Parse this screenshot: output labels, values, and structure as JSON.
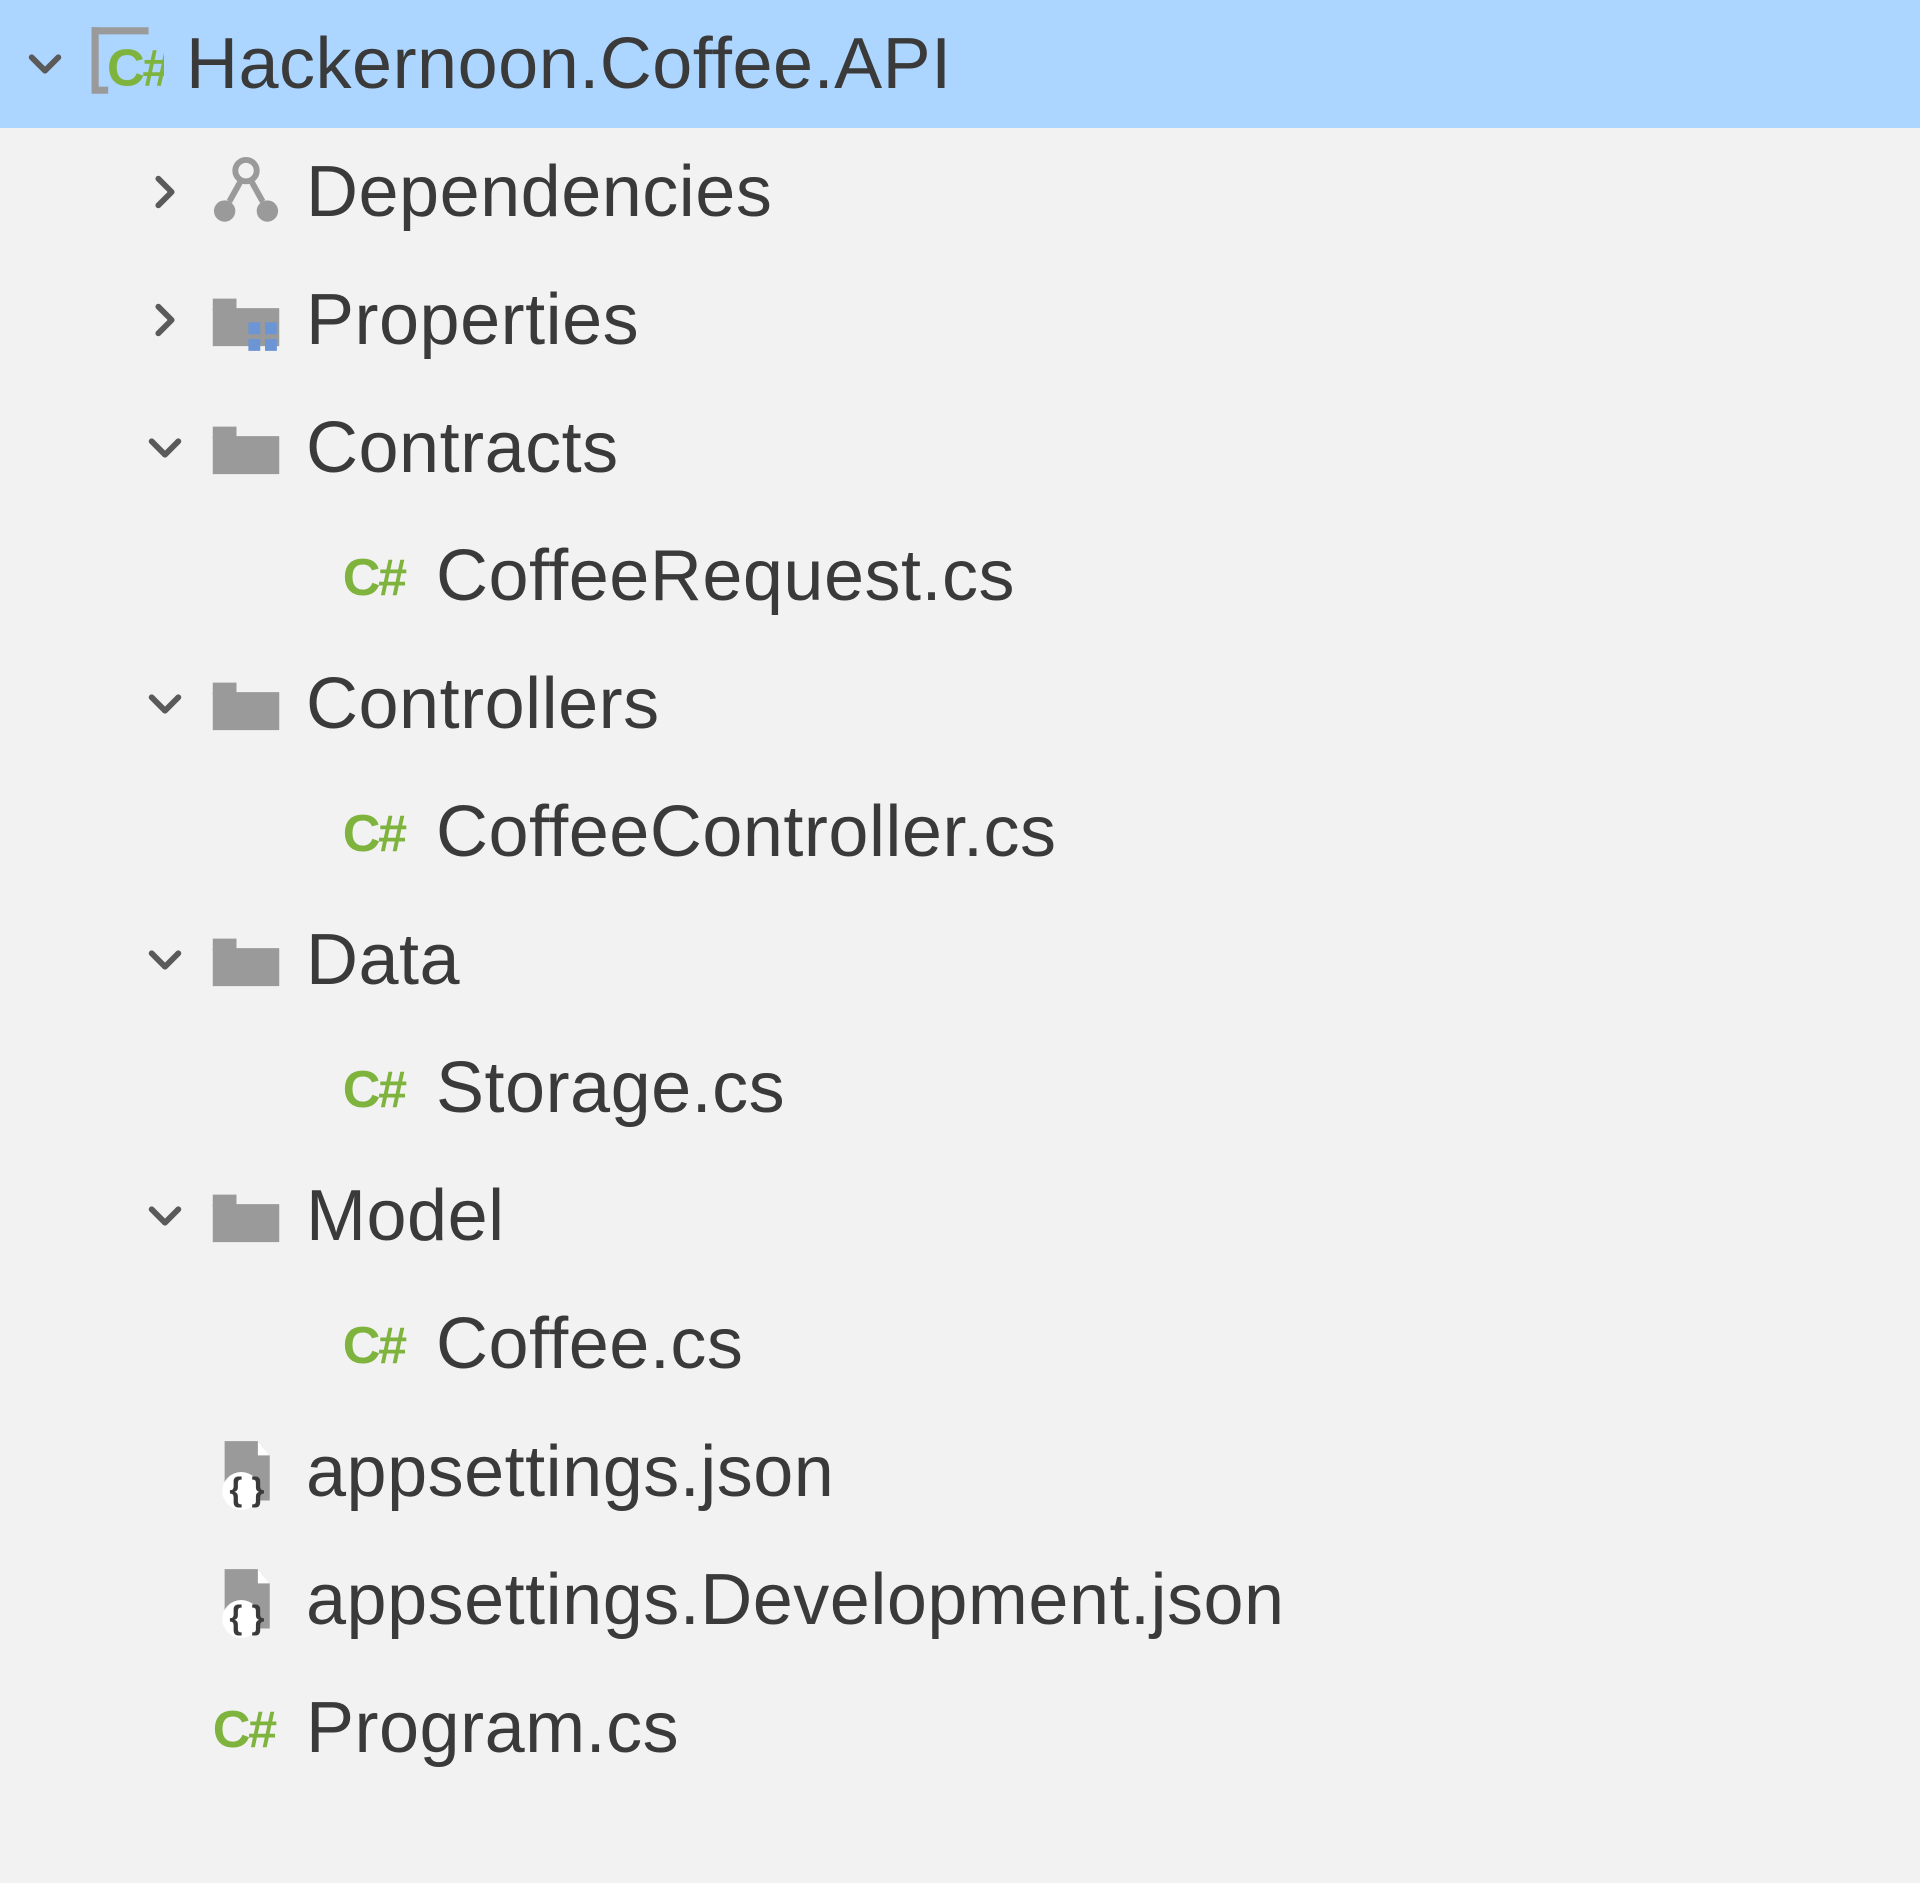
{
  "project": {
    "name": "Hackernoon.Coffee.API"
  },
  "nodes": {
    "dependencies": {
      "label": "Dependencies"
    },
    "properties": {
      "label": "Properties"
    },
    "contracts": {
      "label": "Contracts"
    },
    "contracts_coffeerequest": {
      "label": "CoffeeRequest.cs"
    },
    "controllers": {
      "label": "Controllers"
    },
    "controllers_coffeecontroller": {
      "label": "CoffeeController.cs"
    },
    "data": {
      "label": "Data"
    },
    "data_storage": {
      "label": "Storage.cs"
    },
    "model": {
      "label": "Model"
    },
    "model_coffee": {
      "label": "Coffee.cs"
    },
    "appsettings": {
      "label": "appsettings.json"
    },
    "appsettings_dev": {
      "label": "appsettings.Development.json"
    },
    "program": {
      "label": "Program.cs"
    }
  }
}
